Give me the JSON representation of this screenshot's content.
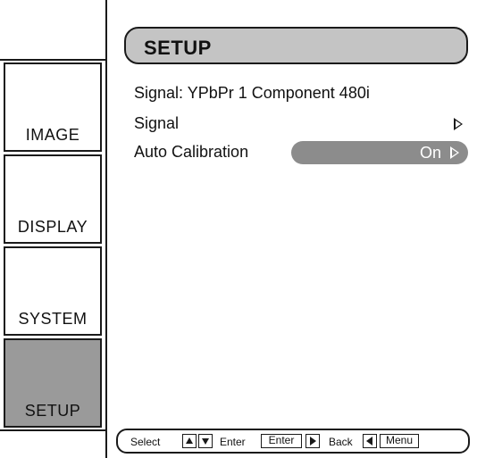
{
  "sidebar": {
    "tabs": [
      {
        "label": "IMAGE",
        "active": false
      },
      {
        "label": "DISPLAY",
        "active": false
      },
      {
        "label": "SYSTEM",
        "active": false
      },
      {
        "label": "SETUP",
        "active": true
      }
    ]
  },
  "header": {
    "title": "SETUP"
  },
  "main": {
    "signal_info": "Signal: YPbPr 1 Component 480i",
    "items": [
      {
        "label": "Signal",
        "value": ""
      },
      {
        "label": "Auto Calibration",
        "value": "On"
      }
    ]
  },
  "footer": {
    "select_label": "Select",
    "enter_label": "Enter",
    "enter_key": "Enter",
    "back_label": "Back",
    "menu_key": "Menu"
  },
  "colors": {
    "active_tab": "#9a9a9a",
    "title_bar": "#c4c4c4",
    "highlight_pill": "#8c8c8c"
  }
}
